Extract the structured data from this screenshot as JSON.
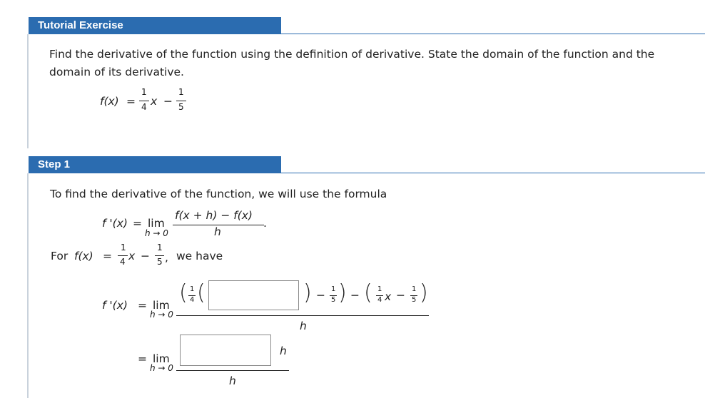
{
  "tutorial": {
    "header": "Tutorial Exercise",
    "instruction_line1": "Find the derivative of the function using the definition of derivative. State the domain of the function and the",
    "instruction_line2": "domain of its derivative.",
    "fx_lhs": "f(x)",
    "eq": "=",
    "one": "1",
    "four": "4",
    "five": "5",
    "x": "x",
    "minus": "−"
  },
  "step1": {
    "header": "Step 1",
    "intro": "To find the derivative of the function, we will use the formula",
    "fprime": "f '(x)",
    "eq": "=",
    "lim": "lim",
    "h_to_0": "h → 0",
    "numerator": "f(x + h) − f(x)",
    "denominator": "h",
    "period": ".",
    "for_label": "For",
    "fx": "f(x)",
    "we_have": "we have",
    "comma": ",",
    "h": "h"
  },
  "inputs": {
    "blank1": "",
    "blank2": ""
  }
}
